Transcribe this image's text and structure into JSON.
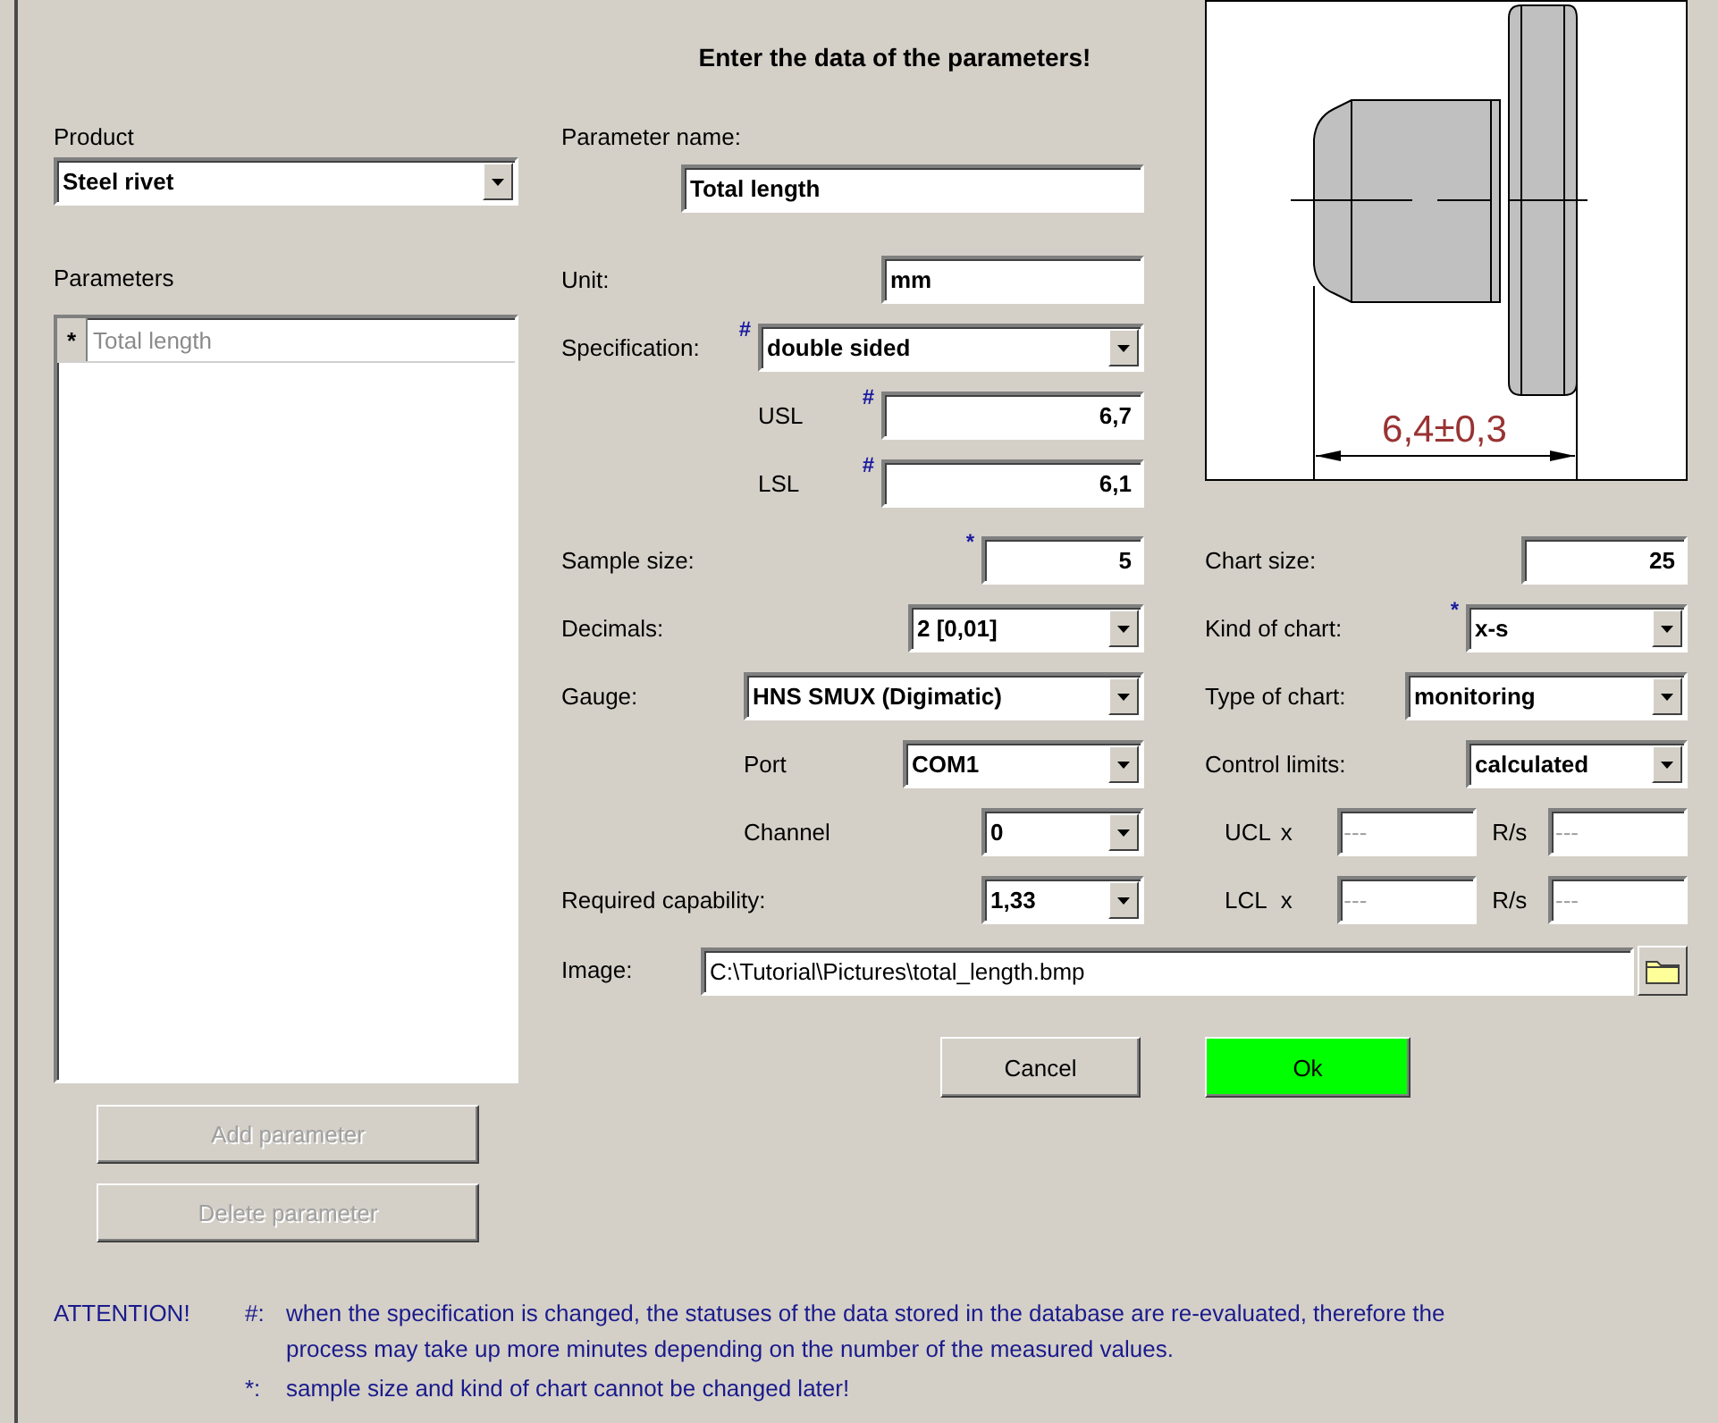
{
  "title": "Enter the data of the parameters!",
  "product": {
    "label": "Product",
    "value": "Steel rivet"
  },
  "parameters": {
    "label": "Parameters",
    "rows": [
      {
        "marker": "*",
        "name": "Total length"
      }
    ]
  },
  "parameter_buttons": [
    {
      "label": "Add parameter",
      "disabled": true
    },
    {
      "label": "Delete parameter",
      "disabled": true
    }
  ],
  "parameter_name": {
    "label": "Parameter name:",
    "value": "Total length"
  },
  "unit": {
    "label": "Unit:",
    "value": "mm"
  },
  "specification": {
    "label": "Specification:",
    "mark": "#",
    "value": "double sided"
  },
  "usl": {
    "label": "USL",
    "mark": "#",
    "value": "6,7"
  },
  "lsl": {
    "label": "LSL",
    "mark": "#",
    "value": "6,1"
  },
  "sample_size": {
    "label": "Sample size:",
    "mark": "*",
    "value": "5"
  },
  "decimals": {
    "label": "Decimals:",
    "value": "2 [0,01]"
  },
  "gauge": {
    "label": "Gauge:",
    "value": "HNS SMUX (Digimatic)"
  },
  "port": {
    "label": "Port",
    "value": "COM1"
  },
  "channel": {
    "label": "Channel",
    "value": "0"
  },
  "required_capability": {
    "label": "Required capability:",
    "value": "1,33"
  },
  "part_drawing": {
    "dimension": "6,4±0,3"
  },
  "chart_size": {
    "label": "Chart size:",
    "value": "25"
  },
  "kind_of_chart": {
    "label": "Kind of chart:",
    "mark": "*",
    "value": "x-s"
  },
  "type_of_chart": {
    "label": "Type of chart:",
    "value": "monitoring"
  },
  "control_limits": {
    "label": "Control limits:",
    "value": "calculated"
  },
  "limits": [
    {
      "label": "UCL",
      "x_label": "x",
      "x_placeholder": "---",
      "rs_label": "R/s",
      "rs_placeholder": "---"
    },
    {
      "label": "LCL",
      "x_label": "x",
      "x_placeholder": "---",
      "rs_label": "R/s",
      "rs_placeholder": "---"
    }
  ],
  "image": {
    "label": "Image:",
    "value": "C:\\Tutorial\\Pictures\\total_length.bmp"
  },
  "actions": [
    {
      "label": "Cancel",
      "kind": "normal"
    },
    {
      "label": "Ok",
      "kind": "primary"
    }
  ],
  "attention": {
    "title": "ATTENTION!",
    "notes": [
      {
        "mark": "#:",
        "text": "when the specification is changed, the statuses of the data stored in the database are re-evaluated, therefore the process may take up more minutes depending on the number of the measured values."
      },
      {
        "mark": "*:",
        "text": "sample size and kind of chart cannot be changed later!"
      }
    ]
  }
}
